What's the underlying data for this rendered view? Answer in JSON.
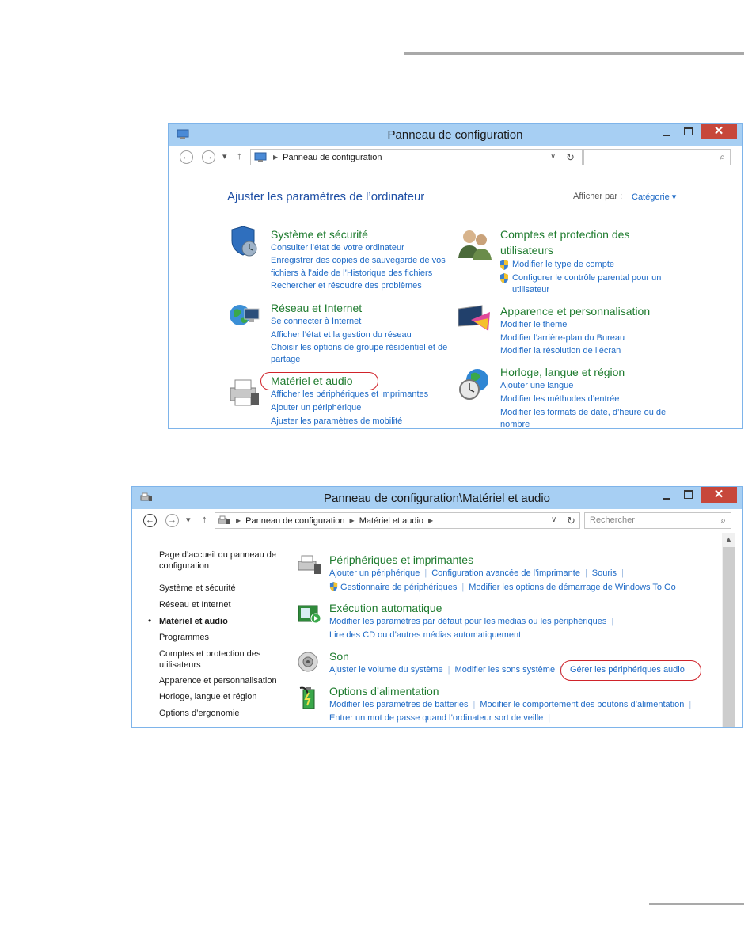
{
  "window1": {
    "title": "Panneau de configuration",
    "close": "✕",
    "breadcrumb": [
      "Panneau de configuration"
    ],
    "heading": "Ajuster les paramètres de l’ordinateur",
    "view_by_label": "Afficher par :",
    "view_by_value": "Catégorie ▾",
    "categories": [
      {
        "title": "Système et sécurité",
        "icon": "security-shield-icon",
        "links": [
          "Consulter l’état de votre ordinateur",
          "Enregistrer des copies de sauvegarde de vos",
          "fichiers à l’aide de l’Historique des fichiers",
          "Rechercher et résoudre des problèmes"
        ]
      },
      {
        "title": "Réseau et Internet",
        "icon": "network-globe-icon",
        "links": [
          "Se connecter à Internet",
          "Afficher l’état et la gestion du réseau",
          "Choisir les options de groupe résidentiel et de",
          "partage"
        ]
      },
      {
        "title": "Matériel et audio",
        "icon": "printer-icon",
        "links": [
          "Afficher les périphériques et imprimantes",
          "Ajouter un périphérique",
          "Ajuster les paramètres de mobilité"
        ]
      },
      {
        "title": "Comptes et protection des",
        "title2": "utilisateurs",
        "icon": "users-icon",
        "links": [
          "Modifier le type de compte",
          "Configurer le contrôle parental pour un",
          "utilisateur"
        ]
      },
      {
        "title": "Apparence et personnalisation",
        "icon": "display-icon",
        "links": [
          "Modifier le thème",
          "Modifier l’arrière-plan du Bureau",
          "Modifier la résolution de l’écran"
        ]
      },
      {
        "title": "Horloge, langue et région",
        "icon": "clock-globe-icon",
        "links": [
          "Ajouter une langue",
          "Modifier les méthodes d’entrée",
          "Modifier les formats de date, d’heure ou de",
          "nombre"
        ]
      }
    ]
  },
  "window2": {
    "title": "Panneau de configuration\\Matériel et audio",
    "close": "✕",
    "breadcrumb": [
      "Panneau de configuration",
      "Matériel et audio"
    ],
    "search_placeholder": "Rechercher",
    "sidebar": [
      "Page d’accueil du panneau de",
      "configuration",
      "Système et sécurité",
      "Réseau et Internet",
      "Matériel et audio",
      "Programmes",
      "Comptes et protection des",
      "utilisateurs",
      "Apparence et personnalisation",
      "Horloge, langue et région",
      "Options d’ergonomie"
    ],
    "sections": [
      {
        "title": "Périphériques et imprimantes",
        "icon": "printer-icon",
        "line1": [
          "Ajouter un périphérique",
          "Configuration avancée de l’imprimante",
          "Souris"
        ],
        "line2": [
          "Gestionnaire de périphériques",
          "Modifier les options de démarrage de Windows To Go"
        ]
      },
      {
        "title": "Exécution automatique",
        "icon": "autoplay-icon",
        "line1": [
          "Modifier les paramètres par défaut pour les médias ou les périphériques"
        ],
        "line2": [
          "Lire des CD ou d’autres médias automatiquement"
        ]
      },
      {
        "title": "Son",
        "icon": "speaker-icon",
        "line1": [
          "Ajuster le volume du système",
          "Modifier les sons système",
          "Gérer les périphériques audio"
        ]
      },
      {
        "title": "Options d’alimentation",
        "icon": "battery-icon",
        "line1": [
          "Modifier les paramètres de batteries",
          "Modifier le comportement des boutons d’alimentation"
        ],
        "line2": [
          "Entrer un mot de passe quand l’ordinateur sort de veille"
        ]
      }
    ]
  }
}
